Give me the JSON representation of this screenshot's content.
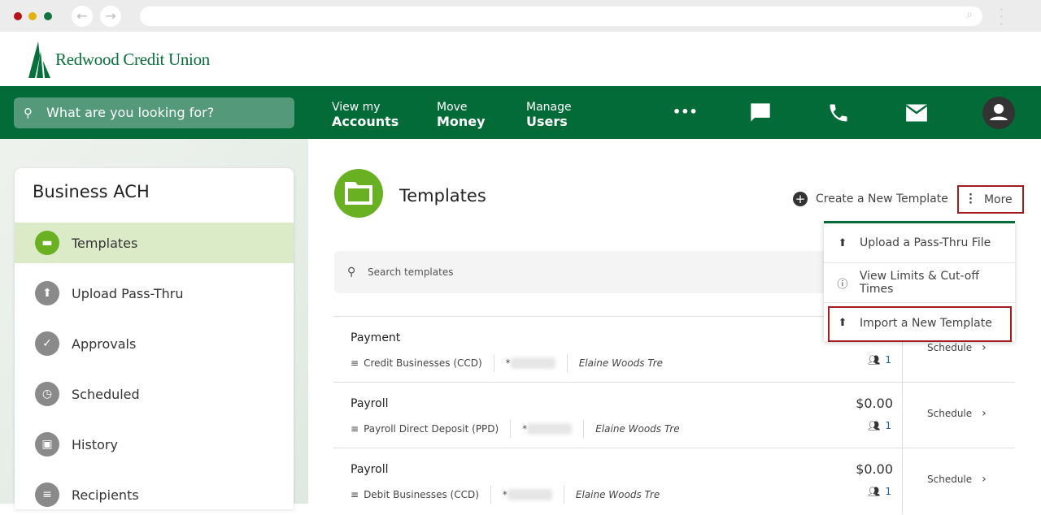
{
  "browser": {
    "back_icon": "arrow-left-icon",
    "forward_icon": "arrow-right-icon",
    "dots": [
      "#b5121b",
      "#e3b20f",
      "#127440"
    ]
  },
  "brand": {
    "name": "Redwood Credit Union",
    "color": "#036b37",
    "accent": "#6ab023"
  },
  "nav": {
    "search_placeholder": "What are you looking for?",
    "items": [
      {
        "top": "View my",
        "bottom": "Accounts"
      },
      {
        "top": "Move",
        "bottom": "Money"
      },
      {
        "top": "Manage",
        "bottom": "Users"
      }
    ],
    "more": "•••"
  },
  "sidebar": {
    "title": "Business ACH",
    "items": [
      {
        "label": "Templates",
        "icon": "folder-icon",
        "active": true
      },
      {
        "label": "Upload Pass-Thru",
        "icon": "upload-icon"
      },
      {
        "label": "Approvals",
        "icon": "clipboard-check-icon"
      },
      {
        "label": "Scheduled",
        "icon": "clock-icon"
      },
      {
        "label": "History",
        "icon": "calendar-check-icon"
      },
      {
        "label": "Recipients",
        "icon": "list-icon"
      }
    ]
  },
  "main": {
    "title": "Templates",
    "create_label": "Create a New Template",
    "more_label": "More",
    "search_placeholder": "Search templates",
    "menu": [
      {
        "label": "Upload a Pass-Thru File",
        "icon": "upload-icon"
      },
      {
        "label": "View Limits & Cut-off Times",
        "icon": "info-icon"
      },
      {
        "label": "Import a New Template",
        "icon": "upload-icon",
        "highlighted": true
      }
    ],
    "rows": [
      {
        "name": "Payment",
        "type": "Credit Businesses (CCD)",
        "account": "*",
        "owner": "Elaine Woods Tre",
        "amount": "",
        "recipients": "1",
        "action": "Schedule"
      },
      {
        "name": "Payroll",
        "type": "Payroll Direct Deposit (PPD)",
        "account": "*",
        "owner": "Elaine Woods Tre",
        "amount": "$0.00",
        "recipients": "1",
        "action": "Schedule"
      },
      {
        "name": "Payroll",
        "type": "Debit Businesses (CCD)",
        "account": "*",
        "owner": "Elaine Woods Tre",
        "amount": "$0.00",
        "recipients": "1",
        "action": "Schedule"
      }
    ]
  }
}
